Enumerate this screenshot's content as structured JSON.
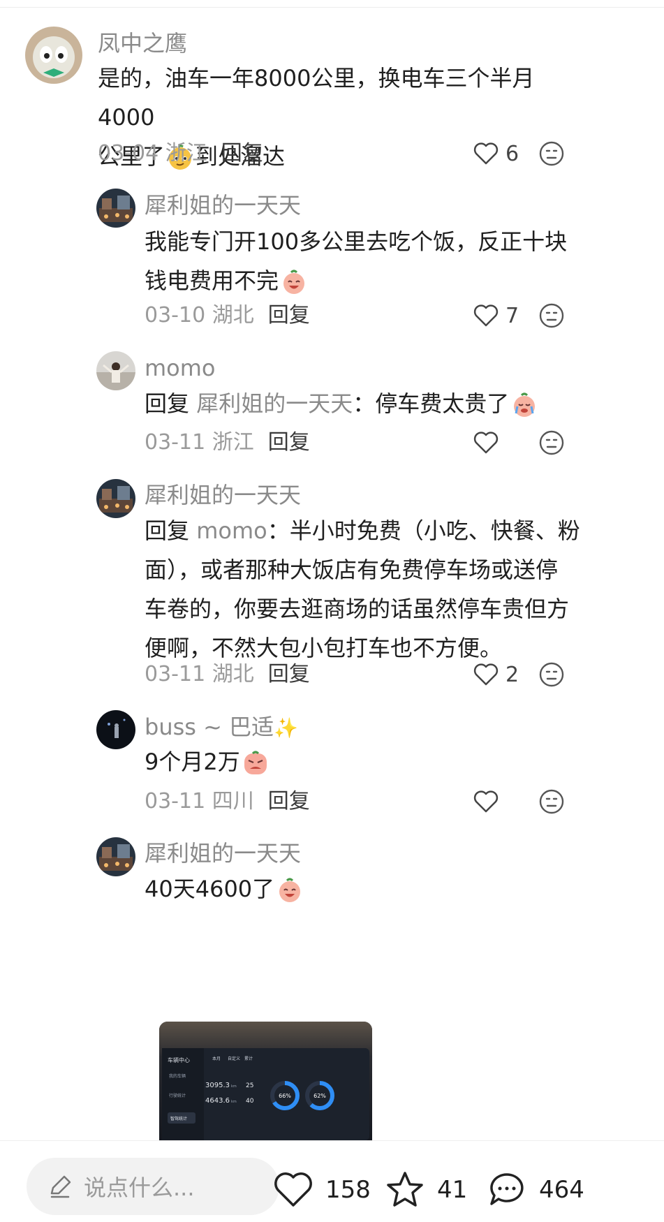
{
  "comments": [
    {
      "name": "凤中之鹰",
      "text1": "是的，油车一年8000公里，换电车三个半月4000",
      "text2": "公里了",
      "text3": "到处溜达",
      "date": "03-04 浙江",
      "reply": "回复",
      "likes": "6",
      "emoji_icon": "smirk-face-icon"
    },
    {
      "name": "犀利姐的一天天",
      "text1": "我能专门开100多公里去吃个饭，反正十块",
      "text2": "钱电费用不完",
      "date": "03-10 湖北",
      "reply": "回复",
      "likes": "7",
      "emoji_icon": "laugh-peach-icon"
    },
    {
      "name": "momo",
      "reply_prefix": "回复",
      "reply_to": "犀利姐的一天天",
      "text1": "：停车费太贵了",
      "date": "03-11 浙江",
      "reply": "回复",
      "likes": "",
      "emoji_icon": "crying-peach-icon"
    },
    {
      "name": "犀利姐的一天天",
      "reply_prefix": "回复",
      "reply_to": "momo",
      "text1": "：半小时免费（小吃、快餐、粉",
      "text2": "面），或者那种大饭店有免费停车场或送停",
      "text3": "车卷的，你要去逛商场的话虽然停车贵但方",
      "text4": "便啊，不然大包小包打车也不方便。",
      "date": "03-11 湖北",
      "reply": "回复",
      "likes": "2"
    },
    {
      "name": "buss ~ 巴适",
      "name_decor": "✨",
      "text1": "9个月2万",
      "date": "03-11 四川",
      "reply": "回复",
      "likes": "",
      "emoji_icon": "angry-peach-icon"
    },
    {
      "name": "犀利姐的一天天",
      "text1": "40天4600了",
      "emoji_icon": "laugh-peach-icon"
    }
  ],
  "photo": {
    "sidebar_title": "车辆中心",
    "menu": [
      "我的车辆",
      "行驶统计",
      "智驾统计"
    ],
    "tabs": [
      "本月",
      "自定义",
      "累计"
    ],
    "stat1": "3095.3",
    "stat1_unit": "km",
    "stat2": "4643.6",
    "stat2_unit": "km",
    "stat3": "25",
    "stat4": "40",
    "ring1": "66%",
    "ring2": "62%",
    "ring1_value": 0.66,
    "ring2_value": 0.62
  },
  "bottom": {
    "placeholder": "说点什么...",
    "likes": "158",
    "favorites": "41",
    "comments": "464"
  },
  "colors": {
    "accent_ring": "#2f8ef5",
    "meta_gray": "#9a9a9a"
  }
}
